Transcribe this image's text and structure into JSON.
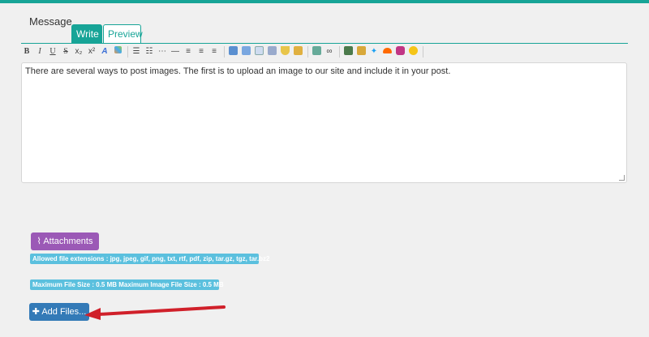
{
  "message_label": "Message",
  "tabs": {
    "write": "Write",
    "preview": "Preview"
  },
  "toolbar": {
    "bold": "B",
    "italic": "I",
    "underline": "U",
    "strike": "S",
    "subscript": "x₂",
    "superscript": "x²",
    "icons": [
      "font-color-icon",
      "highlight-icon",
      "bullet-list-icon",
      "numbered-list-icon",
      "dash-list-icon",
      "horizontal-rule-icon",
      "align-left-icon",
      "align-center-icon",
      "align-right-icon",
      "quote-icon",
      "code-icon",
      "table-icon",
      "spoiler-icon",
      "shield-icon",
      "lock-icon",
      "image-icon",
      "link-icon",
      "video-icon",
      "image-embed-icon",
      "twitter-icon",
      "soundcloud-icon",
      "instagram-icon",
      "smiley-icon"
    ]
  },
  "editor": {
    "content": "There are several ways to post images. The first is to upload an image to our site and include it in your post."
  },
  "attachments_button": "Attachments",
  "allowed_extensions": "Allowed file extensions : jpg, jpeg, gif, png, txt, rtf, pdf, zip, tar.gz, tgz, tar.bz2",
  "max_size": "Maximum File Size : 0.5 MB Maximum Image File Size : 0.5 MB",
  "add_files_button": "Add Files...",
  "colors": {
    "accent": "#17a497",
    "attach": "#9b59b6",
    "badge": "#5bc0de",
    "primary": "#337ab7",
    "arrow": "#d0202a"
  }
}
